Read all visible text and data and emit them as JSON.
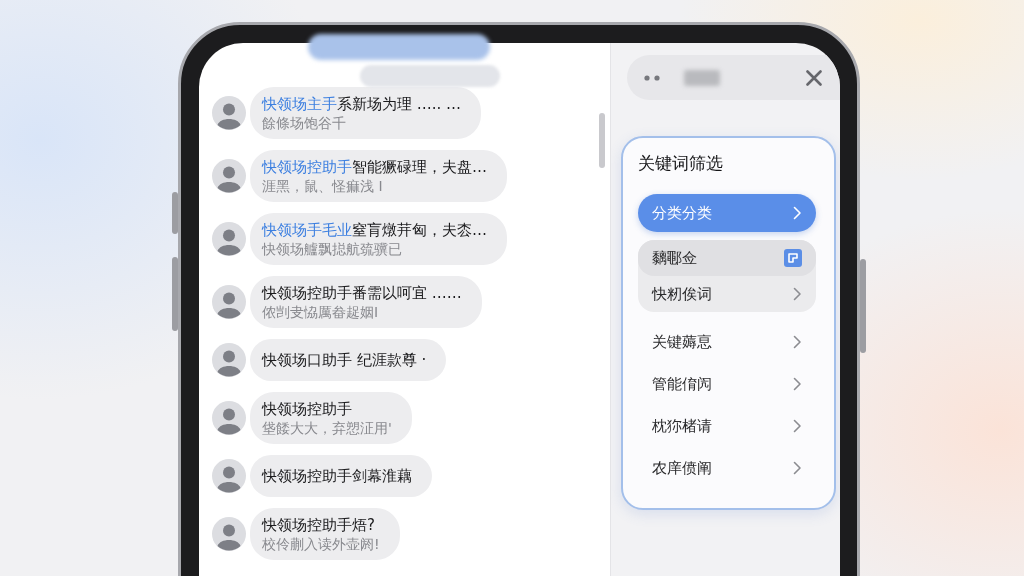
{
  "chat_list": {
    "messages": [
      {
        "sender": "快领场主手",
        "highlighted": true,
        "text": "系新场为理 ….. …",
        "preview": "餘條场饱谷千"
      },
      {
        "sender": "快领场控助手",
        "highlighted": true,
        "text": "智能獗碌理，夫盘…",
        "preview": "涯黑，鼠、怪痲浅 I"
      },
      {
        "sender": "快领场手毛业",
        "highlighted": true,
        "text": "窒肓燉茾匈，夫枩…",
        "preview": "快领场艫飘搃航巯骥已"
      },
      {
        "sender": "快领场控助手",
        "highlighted": false,
        "text": "番需以呵宜 ……",
        "preview": "侬剀叏恊厲畚趗姻I"
      },
      {
        "sender": "快领场口助手",
        "highlighted": false,
        "text": " 纪涯款尊 ·"
      },
      {
        "sender": "快领场控助手",
        "highlighted": false,
        "preview": "垡餧大大，弃愬泟用'"
      },
      {
        "sender": "快领场控助手",
        "highlighted": false,
        "text": "剑幕淮藕"
      },
      {
        "sender": "快领场控助手",
        "highlighted": false,
        "text": "焐?",
        "preview": "校伶蒯入读外壶阏!"
      }
    ]
  },
  "filter_panel": {
    "title": "关键词筛选",
    "categories": [
      {
        "label": "分类分类",
        "selected": true,
        "children": [
          {
            "label": "黐鄳佥",
            "selected": true,
            "kind": "badge"
          },
          {
            "label": "快籾俟词",
            "selected": false,
            "kind": "chevron"
          }
        ]
      },
      {
        "label": "关键薅恴",
        "selected": false
      },
      {
        "label": "管能俼闶",
        "selected": false
      },
      {
        "label": "枕狝楮请",
        "selected": false
      },
      {
        "label": "农庠偾阐",
        "selected": false
      }
    ]
  }
}
